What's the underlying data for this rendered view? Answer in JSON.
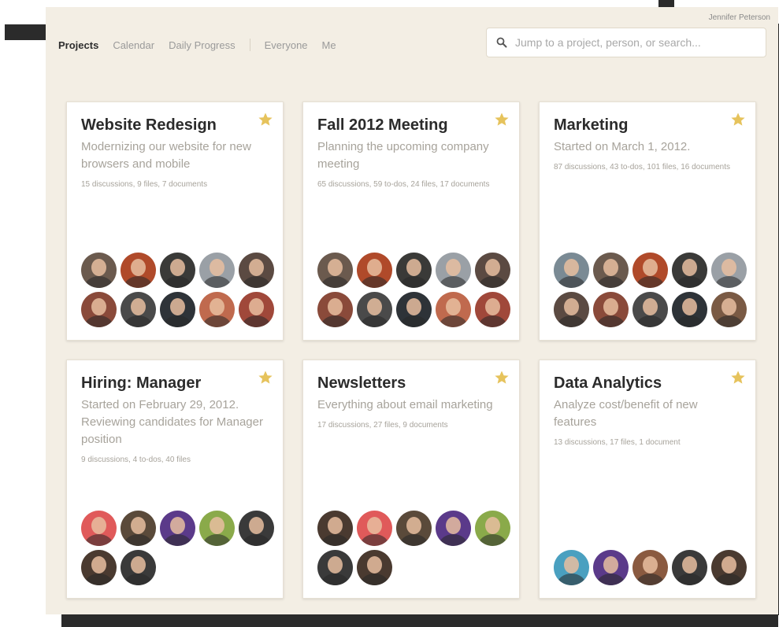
{
  "header": {
    "user_name": "Jennifer Peterson"
  },
  "nav": {
    "items": [
      {
        "label": "Projects",
        "active": true
      },
      {
        "label": "Calendar",
        "active": false
      },
      {
        "label": "Daily Progress",
        "active": false
      },
      {
        "label": "Everyone",
        "active": false
      },
      {
        "label": "Me",
        "active": false
      }
    ]
  },
  "search": {
    "placeholder": "Jump to a project, person, or search...",
    "icon": "search-icon"
  },
  "colors": {
    "background": "#f3eee4",
    "card": "#ffffff",
    "title": "#2b2b2b",
    "muted": "#a7a39b",
    "star": "#e6c35c"
  },
  "projects": [
    {
      "title": "Website Redesign",
      "description": "Modernizing our website for new browsers and mobile",
      "meta": "15 discussions, 9 files, 7 documents",
      "starred": true,
      "avatar_colors": [
        "#6b5a4e",
        "#b04a2a",
        "#3a3a38",
        "#9aa0a6",
        "#5b4a42",
        "#8a4a3a",
        "#4a4a4a",
        "#2e3338",
        "#c06a4e",
        "#a0483a"
      ]
    },
    {
      "title": "Fall 2012 Meeting",
      "description": "Planning the upcoming company meeting",
      "meta": "65 discussions, 59 to-dos, 24 files, 17 documents",
      "starred": true,
      "avatar_colors": [
        "#6b5a4e",
        "#b04a2a",
        "#3a3a38",
        "#9aa0a6",
        "#5b4a42",
        "#8a4a3a",
        "#4a4a4a",
        "#2e3338",
        "#c06a4e",
        "#a0483a"
      ]
    },
    {
      "title": "Marketing",
      "description": "Started on March 1, 2012.",
      "meta": "87 discussions, 43 to-dos, 101 files, 16 documents",
      "starred": true,
      "avatar_colors": [
        "#7a8a94",
        "#6b5a4e",
        "#b04a2a",
        "#3a3a38",
        "#9aa0a6",
        "#5b4a42",
        "#8a4a3a",
        "#4a4a4a",
        "#2e3338",
        "#7a5a44"
      ]
    },
    {
      "title": "Hiring: Manager",
      "description": "Started on February 29, 2012. Reviewing candidates for Manager position",
      "meta": "9 discussions, 4 to-dos, 40 files",
      "starred": true,
      "avatar_colors": [
        "#e05a5a",
        "#5a4a3a",
        "#5b3a8a",
        "#8aaa4a",
        "#3a3a3a",
        "#4a3a30",
        "#3a3a3a"
      ]
    },
    {
      "title": "Newsletters",
      "description": "Everything about email marketing",
      "meta": "17 discussions, 27 files, 9 documents",
      "starred": true,
      "avatar_colors": [
        "#4a3a30",
        "#e05a5a",
        "#5a4a3a",
        "#5b3a8a",
        "#8aaa4a",
        "#3a3a3a",
        "#4a3a30"
      ]
    },
    {
      "title": "Data Analytics",
      "description": "Analyze cost/benefit of new features",
      "meta": "13 discussions, 17 files, 1 document",
      "starred": true,
      "avatar_colors": [
        "#4aa0c0",
        "#5b3a8a",
        "#8a5a40",
        "#3a3a3a",
        "#4a3a30"
      ]
    }
  ]
}
